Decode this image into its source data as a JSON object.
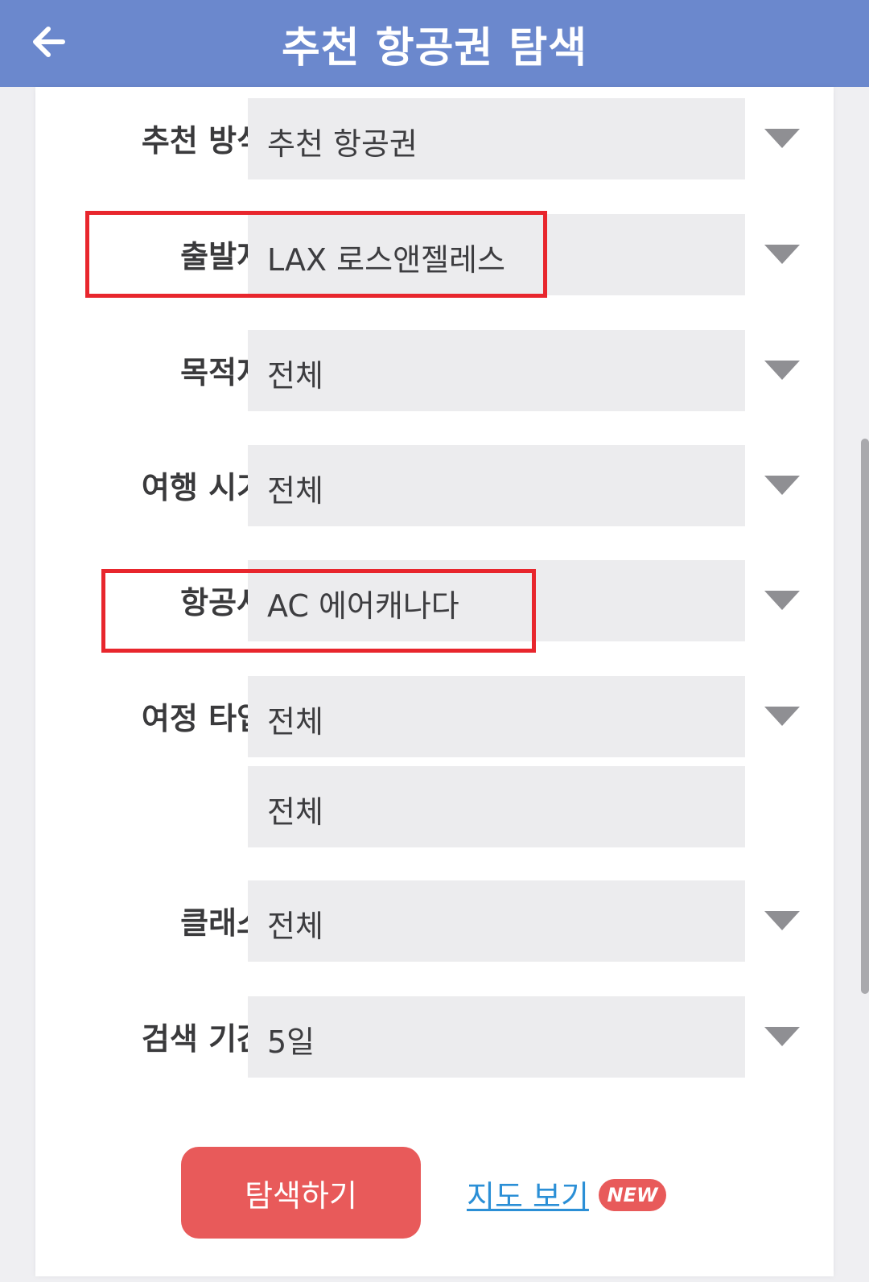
{
  "header": {
    "title": "추천 항공권 탐색",
    "back_icon": "arrow-left-icon"
  },
  "form": {
    "rows": [
      {
        "label": "추천 방식",
        "value": "추천 항공권"
      },
      {
        "label": "출발지",
        "value": "LAX 로스앤젤레스"
      },
      {
        "label": "목적지",
        "value": "전체"
      },
      {
        "label": "여행 시기",
        "value": "전체"
      },
      {
        "label": "항공사",
        "value": "AC 에어캐나다"
      },
      {
        "label": "여정 타입",
        "value": "전체",
        "value2": "전체"
      },
      {
        "label": "클래스",
        "value": "전체"
      },
      {
        "label": "검색 기간",
        "value": "5일"
      }
    ]
  },
  "actions": {
    "search_label": "탐색하기",
    "map_link": "지도 보기",
    "new_badge": "NEW"
  },
  "colors": {
    "header": "#6b88cd",
    "accent": "#e85a5a",
    "link": "#2b8fd6",
    "highlight": "#e8262d"
  }
}
